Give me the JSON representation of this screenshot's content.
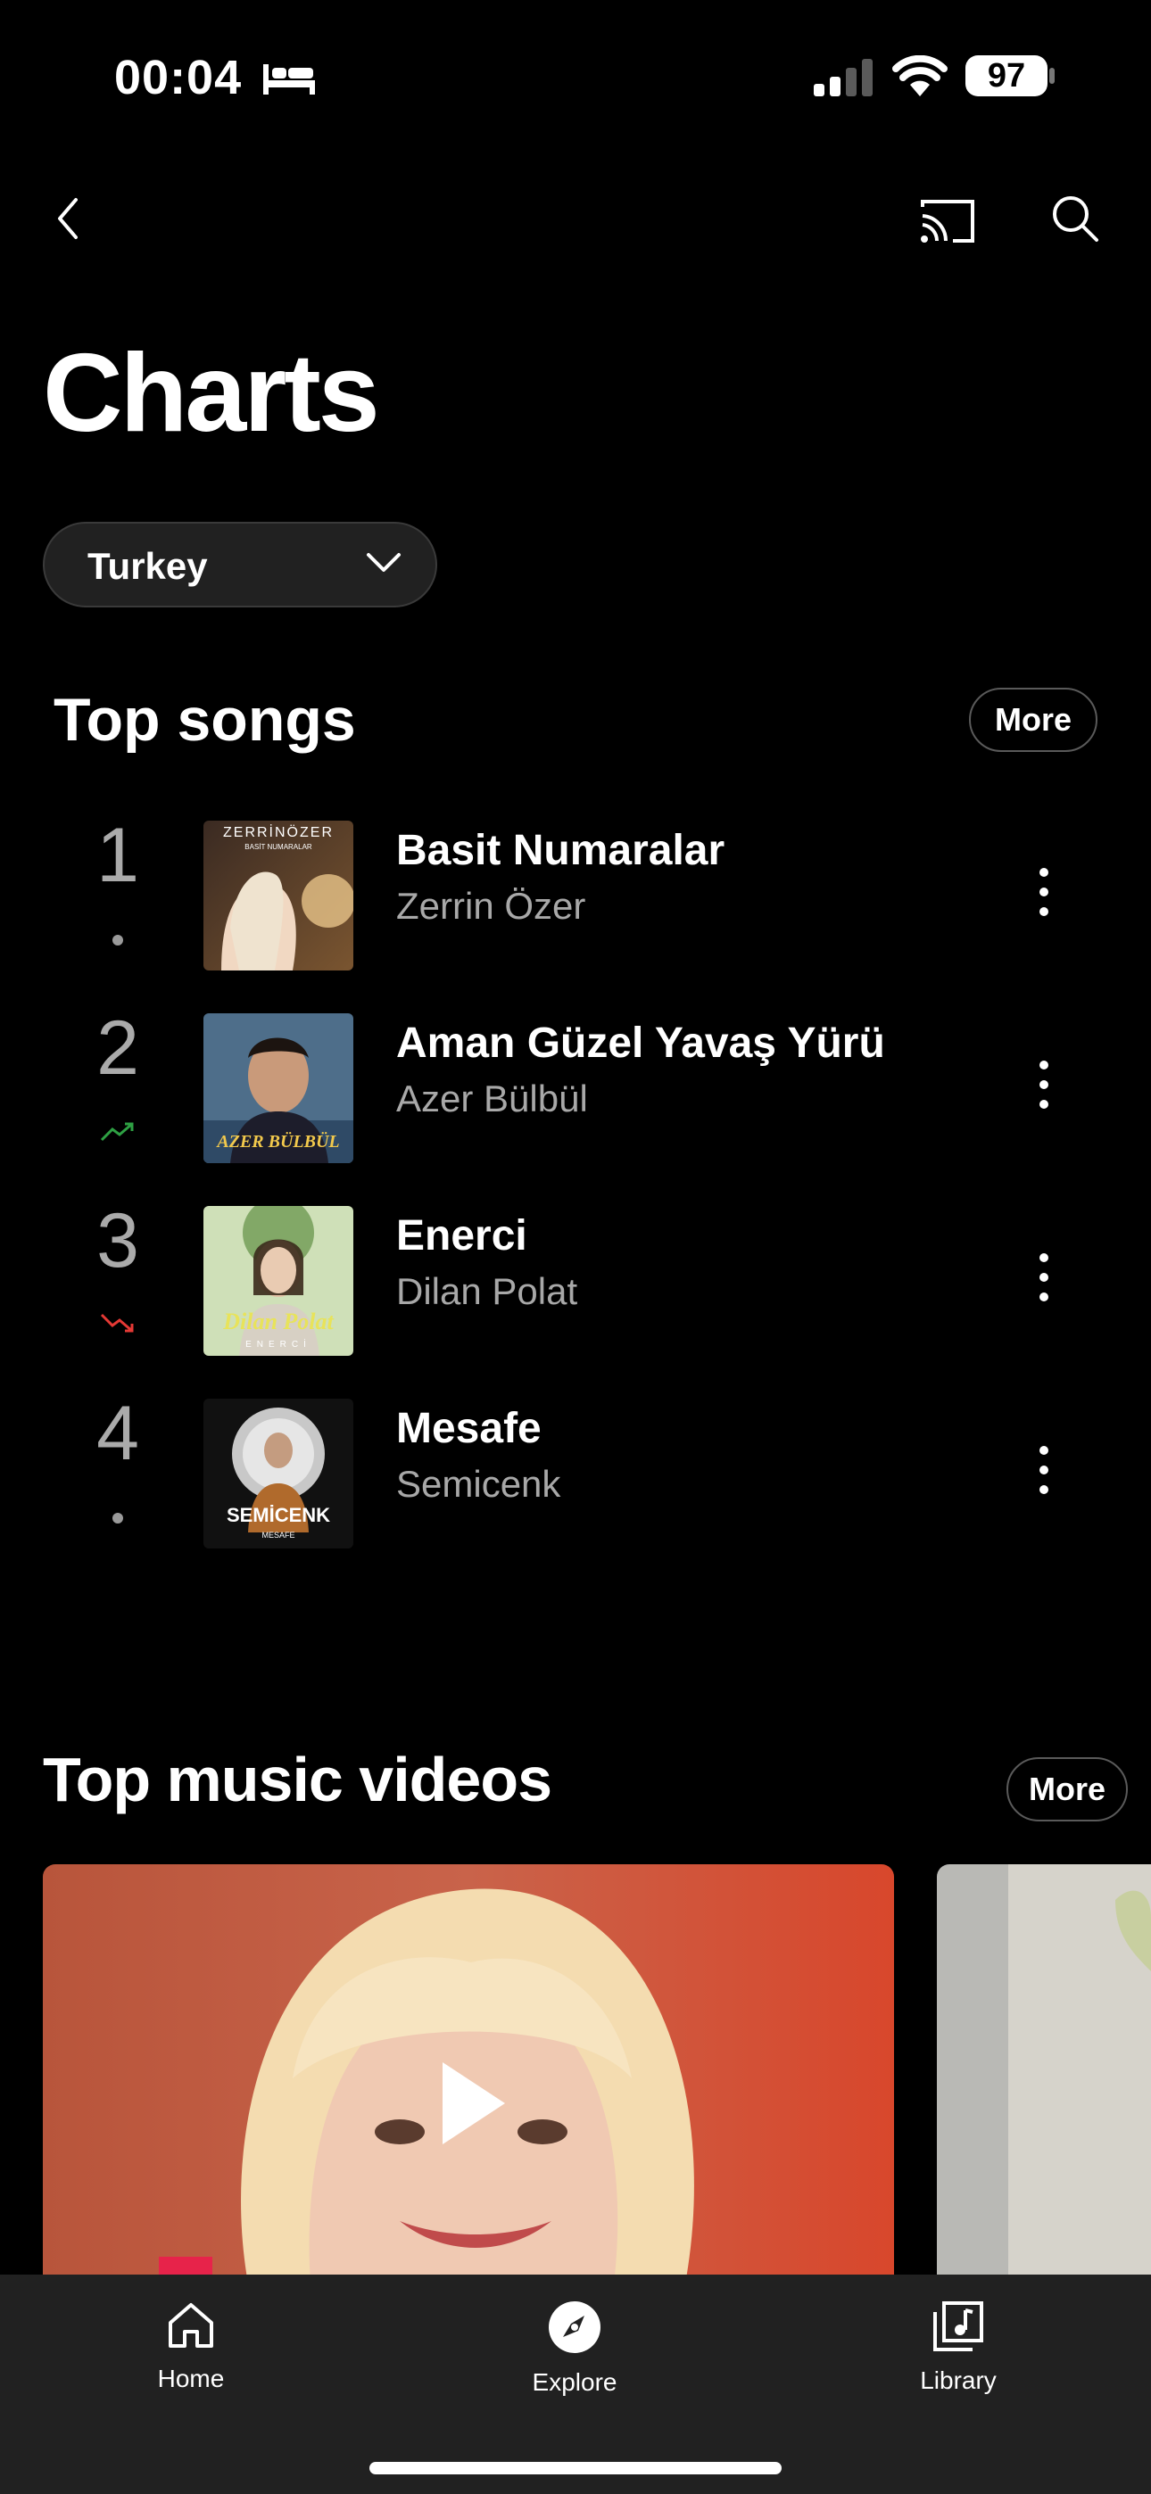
{
  "status_bar": {
    "time": "00:04",
    "battery": "97"
  },
  "header": {
    "title": "Charts"
  },
  "country_selector": {
    "value": "Turkey"
  },
  "top_songs": {
    "title": "Top songs",
    "more_label": "More",
    "items": [
      {
        "rank": "1",
        "trend": "neutral",
        "title": "Basit Numaralar",
        "artist": "Zerrin Özer",
        "art_text_top": "ZERRİNÖZER",
        "art_text_sub": "BASİT NUMARALAR"
      },
      {
        "rank": "2",
        "trend": "up",
        "title": "Aman Güzel Yavaş Yürü",
        "artist": "Azer Bülbül",
        "art_text_top": "AZER BÜLBÜL"
      },
      {
        "rank": "3",
        "trend": "down",
        "title": "Enerci",
        "artist": "Dilan Polat",
        "art_text_top": "Dilan Polat",
        "art_text_sub": "ENERCİ"
      },
      {
        "rank": "4",
        "trend": "neutral",
        "title": "Mesafe",
        "artist": "Semicenk",
        "art_text_top": "SEMİCENK",
        "art_text_sub": "MESAFE"
      }
    ]
  },
  "top_videos": {
    "title": "Top music videos",
    "more_label": "More"
  },
  "bottom_nav": {
    "items": [
      {
        "label": "Home",
        "icon": "home-icon"
      },
      {
        "label": "Explore",
        "icon": "explore-icon",
        "active": true
      },
      {
        "label": "Library",
        "icon": "library-icon"
      }
    ]
  },
  "colors": {
    "background": "#000000",
    "trend_up": "#2ea043",
    "trend_down": "#e53935",
    "nav_bg": "#212121"
  }
}
